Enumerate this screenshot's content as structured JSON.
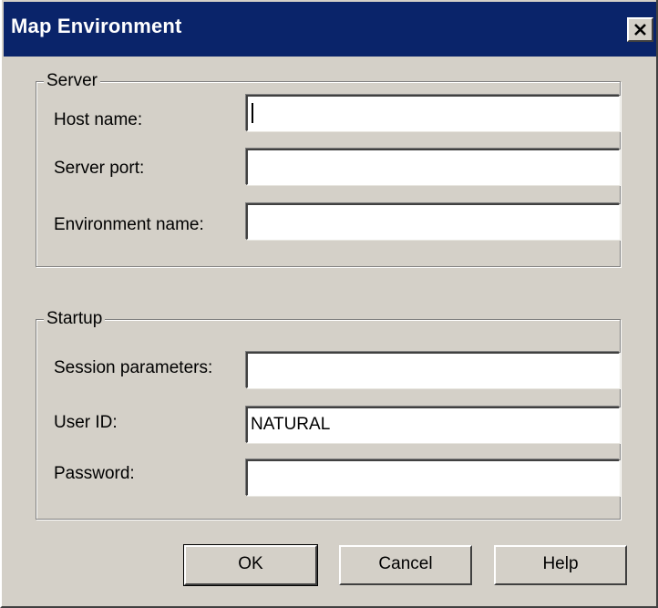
{
  "window": {
    "title": "Map Environment",
    "close_icon": "close-icon"
  },
  "server": {
    "legend": "Server",
    "host_label": "Host name:",
    "host_value": "",
    "port_label": "Server port:",
    "port_value": "",
    "env_label": "Environment name:",
    "env_value": ""
  },
  "startup": {
    "legend": "Startup",
    "session_label": "Session parameters:",
    "session_value": "",
    "userid_label": "User ID:",
    "userid_value": "NATURAL",
    "password_label": "Password:",
    "password_value": ""
  },
  "buttons": {
    "ok": "OK",
    "cancel": "Cancel",
    "help": "Help"
  },
  "colors": {
    "titlebar": "#0a246a",
    "face": "#d4d0c8"
  }
}
